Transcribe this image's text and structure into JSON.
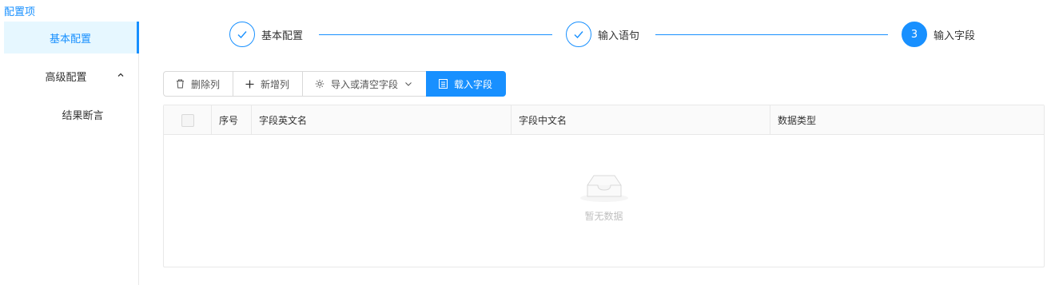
{
  "header": {
    "title": "配置项"
  },
  "sidebar": {
    "items": [
      {
        "label": "基本配置",
        "active": true
      },
      {
        "label": "高级配置",
        "expanded": true
      },
      {
        "label": "结果断言"
      }
    ]
  },
  "steps": [
    {
      "title": "基本配置",
      "status": "finished",
      "icon": "check-icon"
    },
    {
      "title": "输入语句",
      "status": "finished",
      "icon": "check-icon"
    },
    {
      "title": "输入字段",
      "status": "current",
      "number": "3"
    }
  ],
  "toolbar": {
    "delete_column": "删除列",
    "add_column": "新增列",
    "import_clear": "导入或清空字段",
    "load_fields": "载入字段"
  },
  "table": {
    "columns": [
      "序号",
      "字段英文名",
      "字段中文名",
      "数据类型"
    ],
    "empty_text": "暂无数据"
  },
  "colors": {
    "primary": "#1890ff",
    "active_bg": "#e6f7ff"
  }
}
